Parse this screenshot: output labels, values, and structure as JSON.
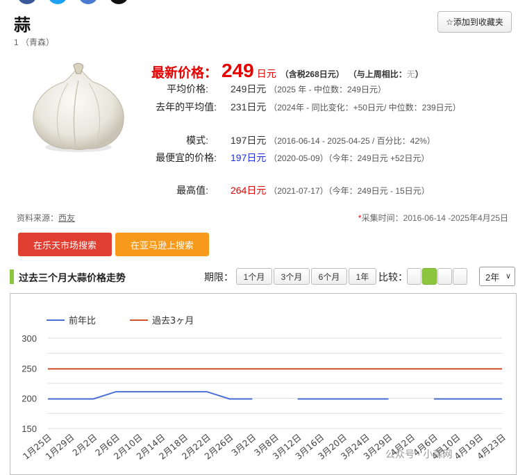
{
  "product": {
    "title": "蒜",
    "subtitle": "1 （青森）"
  },
  "favorite_button": "☆添加到收藏夹",
  "latest": {
    "label": "最新价格：",
    "price": "249",
    "unit": "日元",
    "tax": "（含税268日元）",
    "compare_prefix": "（与上周相比：",
    "compare_value": "无",
    "compare_suffix": "）"
  },
  "stats": {
    "avg": {
      "label": "平均价格:",
      "value": "249日元",
      "note": "（2025 年 - 中位数：249日元）"
    },
    "last_year": {
      "label": "去年的平均值:",
      "value": "231日元",
      "note_a": "（2024年 - 同比变化：",
      "change": "+50日元",
      "note_b": "/ 中位数：239日元）"
    },
    "mode": {
      "label": "模式:",
      "value": "197日元",
      "note": "（2016-06-14 - 2025-04-25 / 百分比：42%）"
    },
    "cheapest": {
      "label": "最便宜的价格:",
      "value": "197日元",
      "note_a": "（2020-05-09）（今年：249日元 ",
      "diff": "+52日元",
      "note_b": "）"
    },
    "highest": {
      "label": "最高值:",
      "value": "264日元",
      "note_a": "（2021-07-17）（今年：249日元 ",
      "diff": "- 15日元",
      "note_b": "）"
    }
  },
  "source": {
    "label": "资料来源：",
    "link": "西友"
  },
  "collected": {
    "star": "*",
    "text": "采集时间：2016-06-14 -2025年4月25日"
  },
  "buttons": {
    "rakuten": "在乐天市场搜索",
    "amazon": "在亚马逊上搜索"
  },
  "section": {
    "title": "过去三个月大蒜价格走势",
    "period_label": "期限：",
    "periods": [
      "1个月",
      "3个月",
      "6个月",
      "1年"
    ],
    "compare_label": "比较：",
    "year_select": "2年"
  },
  "watermark": "公众号 · 小蒜网",
  "colors": {
    "accent_red": "#e60000",
    "accent_blue": "#1e2ee6",
    "green": "#8cc63f",
    "series_last_year": "#4a6fd6",
    "series_past3m": "#d2522b"
  },
  "chart_data": {
    "type": "line",
    "title": "",
    "xlabel": "",
    "ylabel": "",
    "ylim": [
      150,
      300
    ],
    "yticks": [
      150,
      200,
      250,
      300
    ],
    "grid": true,
    "legend_position": "top-left",
    "categories": [
      "1月25日",
      "1月29日",
      "2月2日",
      "2月6日",
      "2月10日",
      "2月14日",
      "2月18日",
      "2月22日",
      "2月26日",
      "3月2日",
      "3月8日",
      "3月12日",
      "3月16日",
      "3月20日",
      "3月24日",
      "3月29日",
      "4月2日",
      "4月6日",
      "4月10日",
      "4月19日",
      "4月23日"
    ],
    "series": [
      {
        "name": "前年比",
        "color": "#4a6fd6",
        "values": [
          199,
          199,
          199,
          211,
          211,
          211,
          211,
          211,
          199,
          199,
          null,
          199,
          199,
          199,
          199,
          199,
          null,
          199,
          199,
          199,
          199
        ]
      },
      {
        "name": "過去3ヶ月",
        "color": "#d2522b",
        "values": [
          249,
          249,
          249,
          249,
          249,
          249,
          249,
          249,
          249,
          249,
          249,
          249,
          249,
          249,
          249,
          249,
          249,
          249,
          249,
          249,
          249
        ]
      }
    ]
  }
}
